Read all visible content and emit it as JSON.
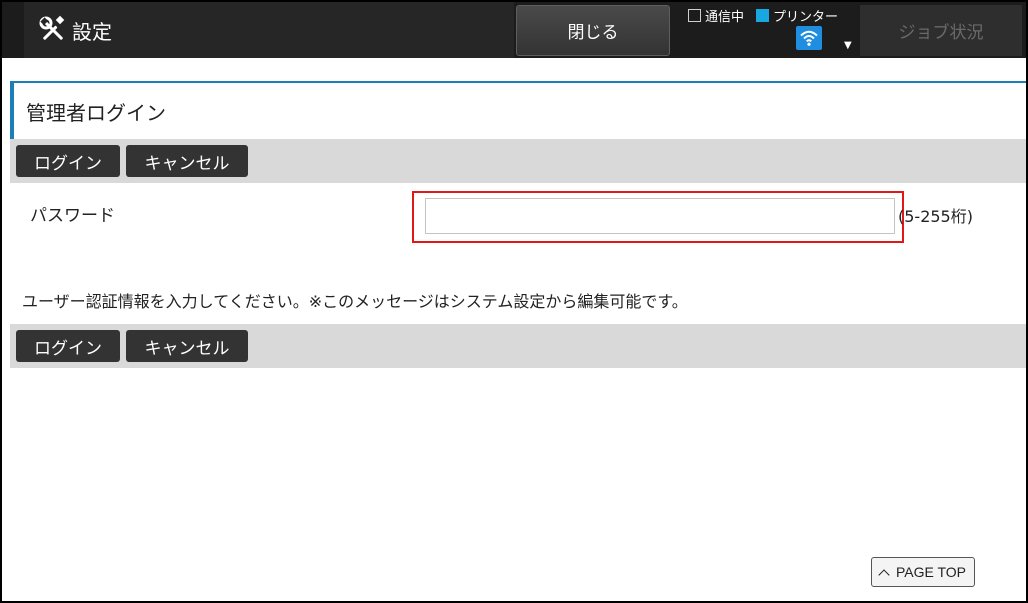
{
  "header": {
    "title": "設定",
    "close_label": "閉じる",
    "status": {
      "comm_label": "通信中",
      "printer_label": "プリンター",
      "printer_color": "#18a7e0",
      "wifi_icon": "wifi-icon"
    },
    "job_status_label": "ジョブ状況"
  },
  "page": {
    "heading": "管理者ログイン",
    "toolbar_top": {
      "login_label": "ログイン",
      "cancel_label": "キャンセル"
    },
    "password": {
      "label": "パスワード",
      "value": "",
      "placeholder": "",
      "hint": "(5-255桁)"
    },
    "info_message": "ユーザー認証情報を入力してください。※このメッセージはシステム設定から編集可能です。",
    "toolbar_bottom": {
      "login_label": "ログイン",
      "cancel_label": "キャンセル"
    },
    "page_top_label": "PAGE TOP"
  },
  "colors": {
    "accent": "#1d7fb8",
    "highlight": "#e01818",
    "header_bg": "#1c1c1c"
  }
}
